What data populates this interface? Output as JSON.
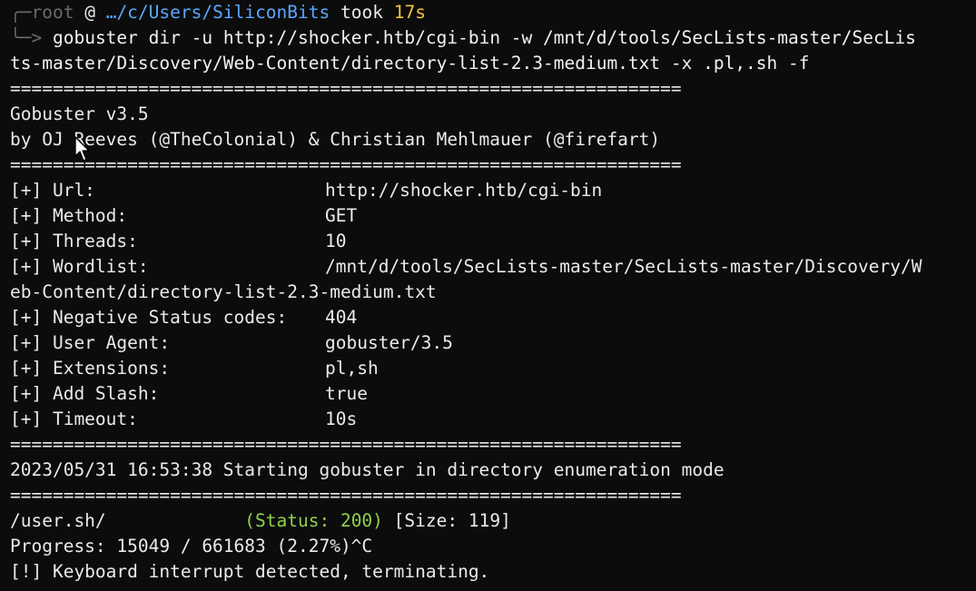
{
  "prompt": {
    "corner_top": "╭─",
    "user": "root",
    "at": "@",
    "path": "…/c/Users/SiliconBits",
    "took": "took",
    "time": "17s",
    "corner_bottom": "╰─",
    "arrow": ">"
  },
  "command": {
    "line1": "gobuster dir -u http://shocker.htb/cgi-bin -w /mnt/d/tools/SecLists-master/SecLis",
    "line2": "ts-master/Discovery/Web-Content/directory-list-2.3-medium.txt -x .pl,.sh -f"
  },
  "separator": "===============================================================",
  "banner": {
    "title": "Gobuster v3.5",
    "authors": "by OJ Reeves (@TheColonial) & Christian Mehlmauer (@firefart)"
  },
  "config": [
    {
      "key": "[+] Url:",
      "value": "http://shocker.htb/cgi-bin"
    },
    {
      "key": "[+] Method:",
      "value": "GET"
    },
    {
      "key": "[+] Threads:",
      "value": "10"
    },
    {
      "key": "[+] Wordlist:",
      "value": "/mnt/d/tools/SecLists-master/SecLists-master/Discovery/W"
    },
    {
      "key": "[+] Negative Status codes:",
      "value": "404"
    },
    {
      "key": "[+] User Agent:",
      "value": "gobuster/3.5"
    },
    {
      "key": "[+] Extensions:",
      "value": "pl,sh"
    },
    {
      "key": "[+] Add Slash:",
      "value": "true"
    },
    {
      "key": "[+] Timeout:",
      "value": "10s"
    }
  ],
  "wordlist_continuation": "eb-Content/directory-list-2.3-medium.txt",
  "start_message": "2023/05/31 16:53:38 Starting gobuster in directory enumeration mode",
  "result": {
    "path": "/user.sh/",
    "status": "(Status: 200)",
    "size": "[Size: 119]"
  },
  "progress": "Progress: 15049 / 661683 (2.27%)^C",
  "interrupt": "[!] Keyboard interrupt detected, terminating.",
  "colors": {
    "background": "#0c0c0c",
    "text": "#eaeaea",
    "path": "#5aa7ff",
    "time": "#f0c445",
    "status_ok": "#8fd14f",
    "dim": "#6b6b6b"
  }
}
